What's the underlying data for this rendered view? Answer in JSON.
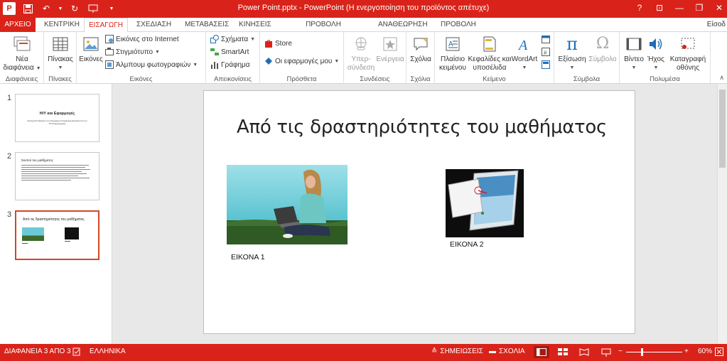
{
  "window": {
    "title": "Power Point.pptx - PowerPoint (Η ενεργοποίηση του προϊόντος απέτυχε)",
    "app_icon": "P",
    "controls": [
      "?",
      "⊡",
      "—",
      "❐",
      "✕"
    ]
  },
  "tabs": [
    {
      "label": "ΑΡΧΕΙΟ",
      "active": false
    },
    {
      "label": "ΚΕΝΤΡΙΚΗ",
      "active": false
    },
    {
      "label": "ΕΙΣΑΓΩΓΗ",
      "active": true
    },
    {
      "label": "ΣΧΕΔΙΑΣΗ",
      "active": false
    },
    {
      "label": "ΜΕΤΑΒΑΣΕΙΣ",
      "active": false
    },
    {
      "label": "ΚΙΝΗΣΕΙΣ",
      "active": false
    },
    {
      "label": "ΠΡΟΒΟΛΗ ΠΑΡΟΥΣΙΑΣΗΣ",
      "active": false
    },
    {
      "label": "ΑΝΑΘΕΩΡΗΣΗ",
      "active": false
    },
    {
      "label": "ΠΡΟΒΟΛΗ",
      "active": false
    }
  ],
  "signin": "Είσοδ",
  "ribbon": {
    "groups": {
      "slides": "Διαφάνειες",
      "tables": "Πίνακες",
      "images": "Εικόνες",
      "illustrations": "Απεικονίσεις",
      "apps": "Πρόσθετα",
      "links": "Συνδέσεις",
      "comments": "Σχόλια",
      "text": "Κείμενο",
      "symbols": "Σύμβολα",
      "media": "Πολυμέσα"
    },
    "new_slide": [
      "Νέα",
      "διαφάνεια"
    ],
    "table": "Πίνακας",
    "pictures": "Εικόνες",
    "online_pictures": "Εικόνες στο Internet",
    "screenshot": "Στιγμιότυπο",
    "photo_album": "Άλμπουμ φωτογραφιών",
    "shapes": "Σχήματα",
    "smartart": "SmartArt",
    "chart": "Γράφημα",
    "store": "Store",
    "my_apps": "Οι εφαρμογές μου",
    "hyperlink": [
      "Υπερ-",
      "σύνδεση"
    ],
    "action": "Ενέργεια",
    "comment": "Σχόλια",
    "textbox": [
      "Πλαίσιο",
      "κειμένου"
    ],
    "header_footer": [
      "Κεφαλίδες και",
      "υποσέλιδα"
    ],
    "wordart": "WordArt",
    "equation": "Εξίσωση",
    "symbol": "Σύμβολο",
    "video": "Βίντεο",
    "audio": "Ήχος",
    "screen_recording": [
      "Καταγραφή",
      "οθόνης"
    ]
  },
  "slides_pane": {
    "numbers": [
      "1",
      "2",
      "3"
    ],
    "slide1": {
      "title": "Η/Υ και Εφαρμογές",
      "subtitle": "Ασλήματ3 Ηλεξρόνι του Προγρέμμε Σαρκέλλικε Ευκαρπόσα του ΤΠ Πληροφορικής"
    },
    "slide2": {
      "title": "Σκοποί του μαθήματος"
    },
    "slide3": {
      "title": "Από τις δραστηριότητες του μαθήματος"
    }
  },
  "slide": {
    "title": "Από τις δραστηριότητες του μαθήματος",
    "caption1": "ΕΙΚΟΝΑ 1",
    "caption2": "ΕΙΚΟΝΑ 2"
  },
  "status": {
    "slide_info": "ΔΙΑΦΑΝΕΙΑ 3 ΑΠΟ 3",
    "language": "ΕΛΛΗΝΙΚΑ",
    "notes": "ΣΗΜΕΙΩΣΕΙΣ",
    "comments": "ΣΧΟΛΙΑ",
    "zoom_minus": "−",
    "zoom_plus": "+",
    "zoom": "60%"
  },
  "colors": {
    "accent": "#d9231a",
    "selected_thumb_border": "#d24726"
  }
}
